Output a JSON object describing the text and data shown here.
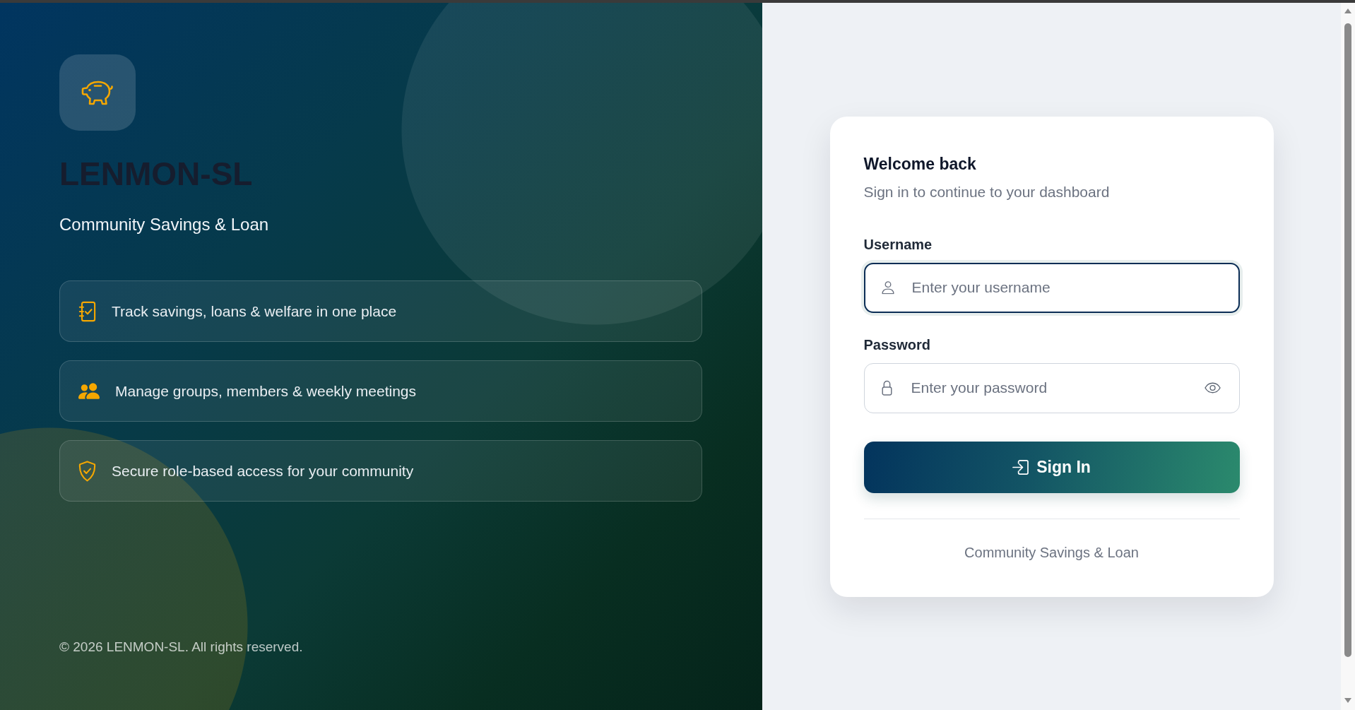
{
  "brand": {
    "name": "LENMON-SL",
    "tagline": "Community Savings & Loan"
  },
  "features": [
    {
      "kind": "journal",
      "text": "Track savings, loans & welfare in one place"
    },
    {
      "kind": "group",
      "text": "Manage groups, members & weekly meetings"
    },
    {
      "kind": "shield",
      "text": "Secure role-based access for your community"
    }
  ],
  "copyright": "© 2026 LENMON-SL. All rights reserved.",
  "login": {
    "title": "Welcome back",
    "subtitle": "Sign in to continue to your dashboard",
    "fields": [
      {
        "kind": "username",
        "label": "Username",
        "placeholder": "Enter your username",
        "focused": true
      },
      {
        "kind": "password",
        "label": "Password",
        "placeholder": "Enter your password",
        "focused": false
      }
    ],
    "submit": "Sign In",
    "footer": "Community Savings & Loan"
  }
}
